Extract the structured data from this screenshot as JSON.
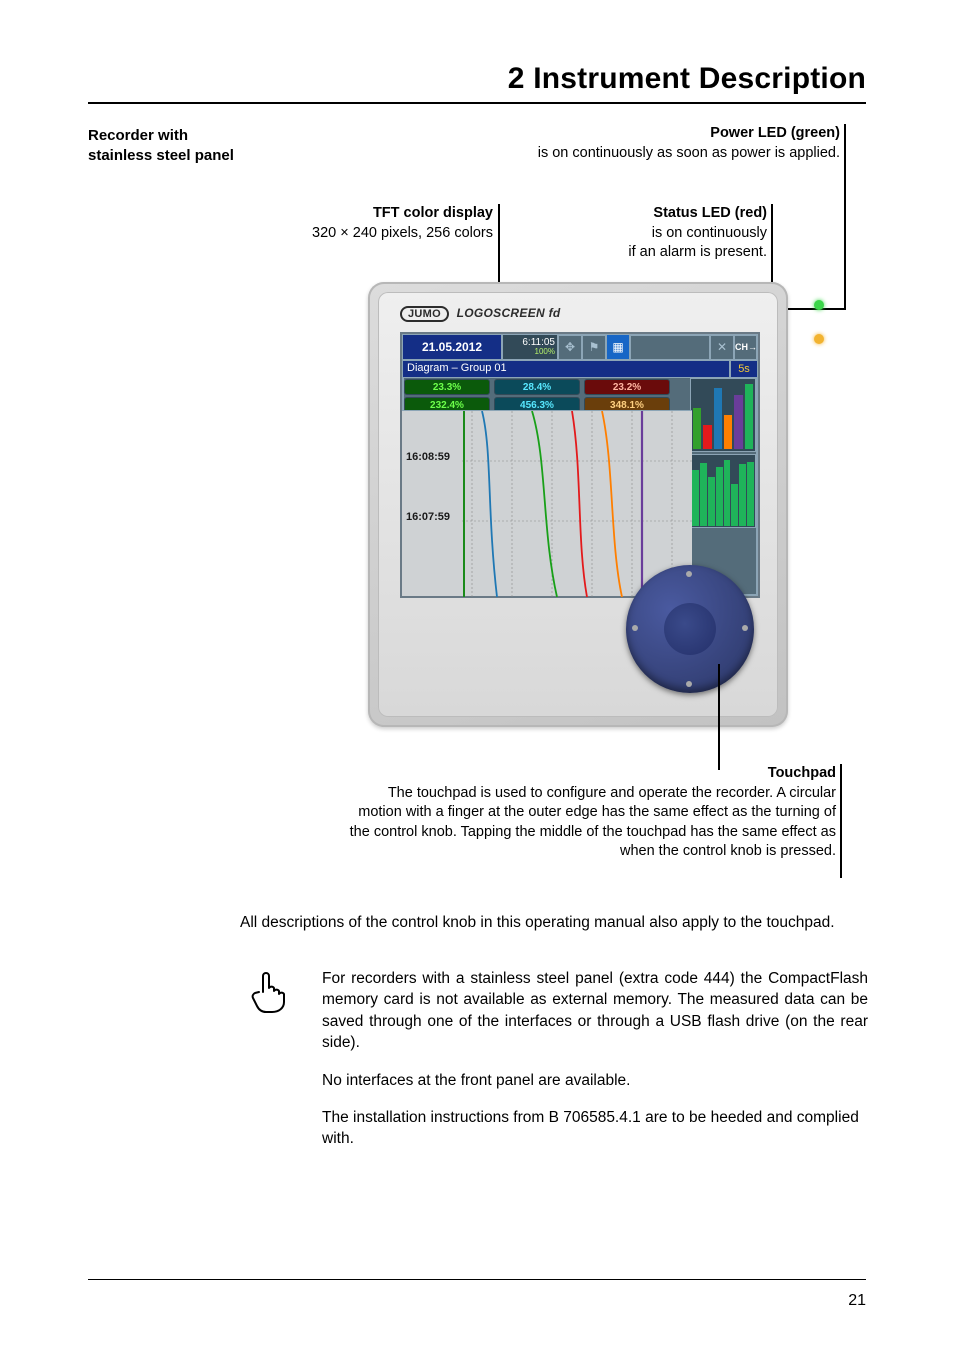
{
  "header": {
    "chapter_title": "2 Instrument Description"
  },
  "sidelabel": "Recorder with stainless steel panel",
  "callouts": {
    "power_led": {
      "title": "Power LED (green)",
      "text": "is on continuously as soon as power is applied."
    },
    "tft": {
      "title": "TFT color display",
      "text": "320 × 240 pixels, 256 colors"
    },
    "status_led": {
      "title": "Status LED (red)",
      "text_l1": "is on continuously",
      "text_l2": "if an alarm is present."
    },
    "touchpad": {
      "title": "Touchpad",
      "text": "The touchpad is used to configure and operate the recorder. A circular motion with a finger at the outer edge has the same effect as the turning of the con­trol knob. Tapping the middle of the touchpad has the same effect as when the control knob is pressed."
    }
  },
  "device": {
    "brand_logo": "JUMO",
    "brand_model": "LOGOSCREEN fd",
    "screen": {
      "date": "21.05.2012",
      "time": "6:11:05",
      "battery": "100%",
      "group_label": "Diagram – Group 01",
      "refresh": "5s",
      "values_row1": [
        "23.3%",
        "28.4%",
        "23.2%"
      ],
      "values_row2": [
        "232.4%",
        "456.3%",
        "348.1%"
      ],
      "time1": "16:08:59",
      "time2": "16:07:59"
    }
  },
  "body": {
    "para1": "All descriptions of the control knob in this operating manual also apply to the touchpad.",
    "note_p1": "For recorders with a stainless steel panel (extra code 444) the CompactFlash memory card is not available as external memory. The measured data can be saved through one of the interfaces or through a USB flash drive (on the rear side).",
    "note_p2": "No interfaces at the front panel are available.",
    "note_p3": "The installation instructions from B 706585.4.1 are to be heeded and complied with."
  },
  "page_number": "21"
}
